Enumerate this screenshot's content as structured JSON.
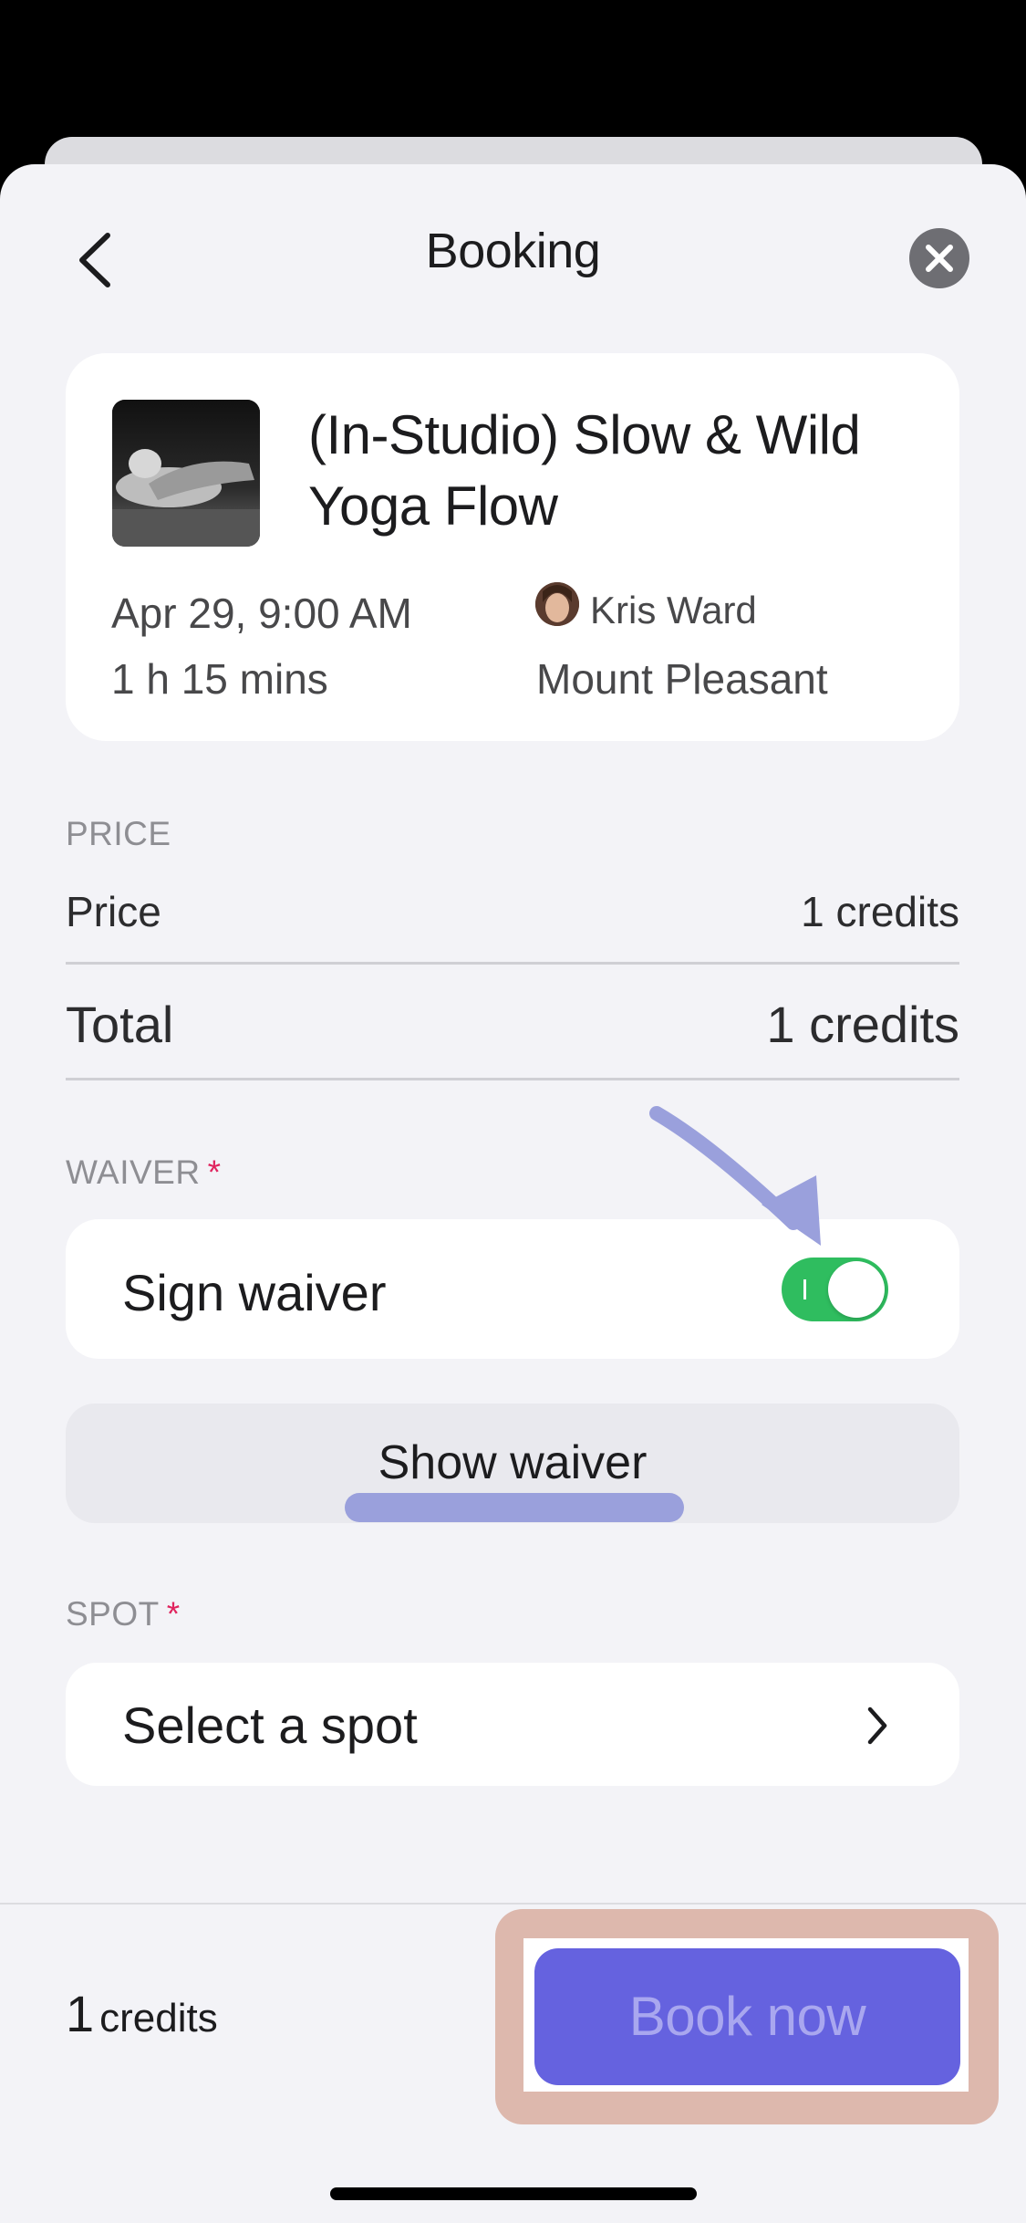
{
  "header": {
    "title": "Booking"
  },
  "class_info": {
    "title": "(In-Studio) Slow & Wild Yoga Flow",
    "date_time": "Apr 29, 9:00 AM",
    "duration": "1 h 15 mins",
    "instructor": "Kris Ward",
    "location": "Mount Pleasant"
  },
  "price_section": {
    "label": "PRICE",
    "price_label": "Price",
    "price_value": "1 credits",
    "total_label": "Total",
    "total_value": "1 credits"
  },
  "waiver_section": {
    "label": "WAIVER",
    "required_mark": "*",
    "sign_label": "Sign waiver",
    "sign_toggle_on": true,
    "show_button": "Show waiver"
  },
  "spot_section": {
    "label": "SPOT",
    "required_mark": "*",
    "select_label": "Select a spot"
  },
  "footer": {
    "credits_count": "1",
    "credits_unit": "credits",
    "book_button": "Book now"
  },
  "colors": {
    "accent": "#6562df",
    "toggle_on": "#2fbd5f",
    "required": "#e0245e",
    "annotation": "#9aa0dc",
    "highlight_box": "#ddb8ad"
  }
}
